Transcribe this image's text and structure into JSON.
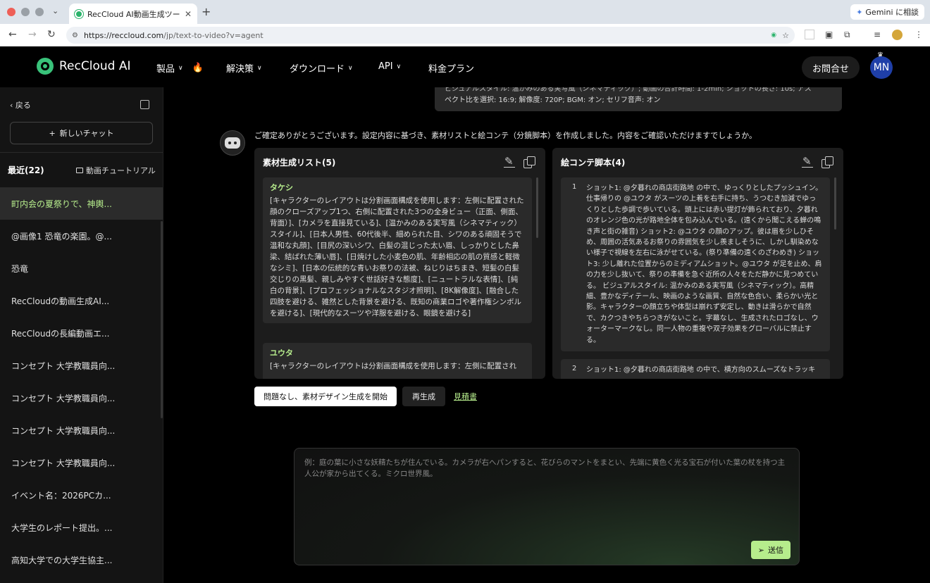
{
  "browser": {
    "tab_title": "RecCloud AI動画生成ツール - ラ",
    "tab_close": "✕",
    "new_tab": "+",
    "gemini_label": "Gemini に相談",
    "url_host": "https://reccloud.com",
    "url_path": "/jp/text-to-video?v=agent"
  },
  "header": {
    "logo_text": "RecCloud AI",
    "nav": [
      {
        "label": "製品"
      },
      {
        "label": "解決策"
      },
      {
        "label": "ダウンロード"
      },
      {
        "label": "API"
      },
      {
        "label": "料金プラン"
      }
    ],
    "contact": "お問合せ",
    "avatar": "MN"
  },
  "sidebar": {
    "back": "戻る",
    "new_chat": "新しいチャット",
    "recent": "最近(22)",
    "tutorial": "動画チュートリアル",
    "items": [
      {
        "label": "町内会の夏祭りで、神輿..."
      },
      {
        "label": "@画像1 恐竜の楽園。@..."
      },
      {
        "label": "恐竜"
      },
      {
        "label": "RecCloudの動画生成AI..."
      },
      {
        "label": "RecCloudの長編動画エ..."
      },
      {
        "label": "コンセプト 大学教職員向..."
      },
      {
        "label": "コンセプト 大学教職員向..."
      },
      {
        "label": "コンセプト 大学教職員向..."
      },
      {
        "label": "コンセプト 大学教職員向..."
      },
      {
        "label": "イベント名：2026PCカ..."
      },
      {
        "label": "大学生のレポート提出。..."
      },
      {
        "label": "高知大学での大学生協主..."
      }
    ]
  },
  "chat": {
    "user_line_cut": "ビジュアルスタイル: 温かみのある実写風（シネマティック）; 動画の合計時間: 1-2min; ショットの長さ: 10s; アス",
    "user_line": "ペクト比を選択: 16:9; 解像度: 720P; BGM: オン; セリフ音声: オン",
    "intro": "ご確定ありがとうございます。設定内容に基づき、素材リストと絵コンテ（分鏡脚本）を作成しました。内容をご確認いただけますでしょうか。",
    "materials": {
      "title": "素材生成リスト(5)",
      "items": [
        {
          "name": "タケシ",
          "desc": "[キャラクターのレイアウトは分割画面構成を使用します：左側に配置された顔のクローズアップ1つ、右側に配置された3つの全身ビュー（正面、側面、背面）]、[カメラを直接見ている]、[温かみのある実写風（シネマティック） スタイル]、[日本人男性、60代後半、細められた目、シワのある頑固そうで温和な丸顔]、[目尻の深いシワ、白髪の混じった太い眉、しっかりとした鼻梁、結ばれた薄い唇]、[日焼けした小麦色の肌、年齢相応の肌の質感と軽微なシミ]、[日本の伝統的な青いお祭りの法被、ねじりはちまき、短髪の白髪交じりの黒髪、親しみやすく世話好きな態度]、[ニュートラルな表情]、[純白の背景]、[プロフェッショナルなスタジオ照明]、[8K解像度]、[融合した四肢を避ける、雑然とした背景を避ける、既知の商業ロゴや著作権シンボルを避ける]、[現代的なスーツや洋服を避ける、眼鏡を避ける]"
        },
        {
          "name": "ユウタ",
          "desc": "[キャラクターのレイアウトは分割画面構成を使用します：左側に配置され"
        }
      ]
    },
    "storyboard": {
      "title": "絵コンテ脚本(4)",
      "items": [
        {
          "num": "1",
          "text": "ショット1: @夕暮れの商店街路地 の中で、ゆっくりとしたプッシュイン。仕事帰りの @ユウタ がスーツの上着を右手に持ち、うつむき加減でゆっくりとした歩調で歩いている。頭上には赤い提灯が飾られており、夕暮れのオレンジ色の光が路地全体を包み込んでいる。(遠くから聞こえる蝉の鳴き声と街の雑音) ショット2: @ユウタ の顔のアップ。彼は眉を少しひそめ、周囲の活気あるお祭りの雰囲気を少し羨ましそうに、しかし馴染めない様子で視線を左右に泳がせている。(祭り準備の遠くのざわめき) ショット3: 少し離れた位置からのミディアムショット。@ユウタ が足を止め、肩の力を少し抜いて、祭りの準備を急ぐ近所の人々をただ静かに見つめている。 ビジュアルスタイル: 温かみのある実写風（シネマティック）。高精細、豊かなディテール、映画のような画質、自然な色合い、柔らかい光と影。キャラクターの顔立ちや体型は崩れず安定し、動きは滑らかで自然で、カクつきやちらつきがないこと。字幕なし、生成されたロゴなし、ウォーターマークなし。同一人物の重複や双子効果をグローバルに禁止する。"
        },
        {
          "num": "2",
          "text": "ショット1: @夕暮れの商店街路地 の中で、横方向のスムーズなトラッキ"
        }
      ]
    },
    "actions": {
      "confirm": "問題なし、素材デザイン生成を開始",
      "regenerate": "再生成",
      "estimate": "見積書"
    }
  },
  "composer": {
    "placeholder": "例：庭の葉に小さな妖精たちが住んでいる。カメラが右へパンすると、花びらのマントをまとい、先端に黄色く光る宝石が付いた葉の杖を持つ主人公が家から出てくる。ミクロ世界風。",
    "value": "",
    "send": "送信"
  },
  "colors": {
    "accent": "#b6ec8c",
    "brand": "#39c27a",
    "avatar_bg": "#1f3fa8"
  }
}
